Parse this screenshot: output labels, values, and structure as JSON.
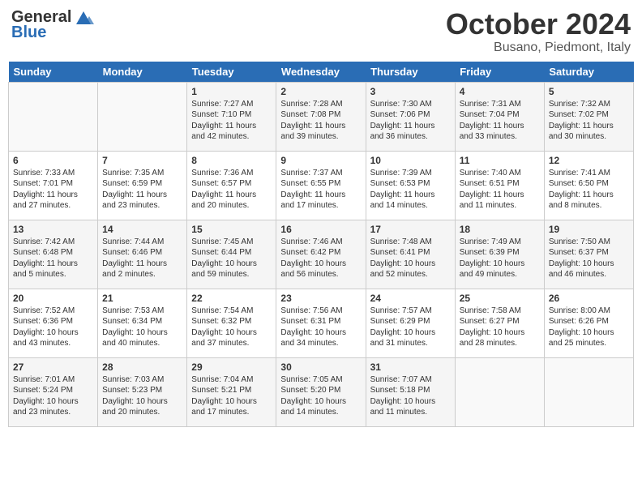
{
  "header": {
    "logo_general": "General",
    "logo_blue": "Blue",
    "month": "October 2024",
    "location": "Busano, Piedmont, Italy"
  },
  "days_of_week": [
    "Sunday",
    "Monday",
    "Tuesday",
    "Wednesday",
    "Thursday",
    "Friday",
    "Saturday"
  ],
  "weeks": [
    [
      {
        "day": "",
        "sunrise": "",
        "sunset": "",
        "daylight": ""
      },
      {
        "day": "",
        "sunrise": "",
        "sunset": "",
        "daylight": ""
      },
      {
        "day": "1",
        "sunrise": "Sunrise: 7:27 AM",
        "sunset": "Sunset: 7:10 PM",
        "daylight": "Daylight: 11 hours and 42 minutes."
      },
      {
        "day": "2",
        "sunrise": "Sunrise: 7:28 AM",
        "sunset": "Sunset: 7:08 PM",
        "daylight": "Daylight: 11 hours and 39 minutes."
      },
      {
        "day": "3",
        "sunrise": "Sunrise: 7:30 AM",
        "sunset": "Sunset: 7:06 PM",
        "daylight": "Daylight: 11 hours and 36 minutes."
      },
      {
        "day": "4",
        "sunrise": "Sunrise: 7:31 AM",
        "sunset": "Sunset: 7:04 PM",
        "daylight": "Daylight: 11 hours and 33 minutes."
      },
      {
        "day": "5",
        "sunrise": "Sunrise: 7:32 AM",
        "sunset": "Sunset: 7:02 PM",
        "daylight": "Daylight: 11 hours and 30 minutes."
      }
    ],
    [
      {
        "day": "6",
        "sunrise": "Sunrise: 7:33 AM",
        "sunset": "Sunset: 7:01 PM",
        "daylight": "Daylight: 11 hours and 27 minutes."
      },
      {
        "day": "7",
        "sunrise": "Sunrise: 7:35 AM",
        "sunset": "Sunset: 6:59 PM",
        "daylight": "Daylight: 11 hours and 23 minutes."
      },
      {
        "day": "8",
        "sunrise": "Sunrise: 7:36 AM",
        "sunset": "Sunset: 6:57 PM",
        "daylight": "Daylight: 11 hours and 20 minutes."
      },
      {
        "day": "9",
        "sunrise": "Sunrise: 7:37 AM",
        "sunset": "Sunset: 6:55 PM",
        "daylight": "Daylight: 11 hours and 17 minutes."
      },
      {
        "day": "10",
        "sunrise": "Sunrise: 7:39 AM",
        "sunset": "Sunset: 6:53 PM",
        "daylight": "Daylight: 11 hours and 14 minutes."
      },
      {
        "day": "11",
        "sunrise": "Sunrise: 7:40 AM",
        "sunset": "Sunset: 6:51 PM",
        "daylight": "Daylight: 11 hours and 11 minutes."
      },
      {
        "day": "12",
        "sunrise": "Sunrise: 7:41 AM",
        "sunset": "Sunset: 6:50 PM",
        "daylight": "Daylight: 11 hours and 8 minutes."
      }
    ],
    [
      {
        "day": "13",
        "sunrise": "Sunrise: 7:42 AM",
        "sunset": "Sunset: 6:48 PM",
        "daylight": "Daylight: 11 hours and 5 minutes."
      },
      {
        "day": "14",
        "sunrise": "Sunrise: 7:44 AM",
        "sunset": "Sunset: 6:46 PM",
        "daylight": "Daylight: 11 hours and 2 minutes."
      },
      {
        "day": "15",
        "sunrise": "Sunrise: 7:45 AM",
        "sunset": "Sunset: 6:44 PM",
        "daylight": "Daylight: 10 hours and 59 minutes."
      },
      {
        "day": "16",
        "sunrise": "Sunrise: 7:46 AM",
        "sunset": "Sunset: 6:42 PM",
        "daylight": "Daylight: 10 hours and 56 minutes."
      },
      {
        "day": "17",
        "sunrise": "Sunrise: 7:48 AM",
        "sunset": "Sunset: 6:41 PM",
        "daylight": "Daylight: 10 hours and 52 minutes."
      },
      {
        "day": "18",
        "sunrise": "Sunrise: 7:49 AM",
        "sunset": "Sunset: 6:39 PM",
        "daylight": "Daylight: 10 hours and 49 minutes."
      },
      {
        "day": "19",
        "sunrise": "Sunrise: 7:50 AM",
        "sunset": "Sunset: 6:37 PM",
        "daylight": "Daylight: 10 hours and 46 minutes."
      }
    ],
    [
      {
        "day": "20",
        "sunrise": "Sunrise: 7:52 AM",
        "sunset": "Sunset: 6:36 PM",
        "daylight": "Daylight: 10 hours and 43 minutes."
      },
      {
        "day": "21",
        "sunrise": "Sunrise: 7:53 AM",
        "sunset": "Sunset: 6:34 PM",
        "daylight": "Daylight: 10 hours and 40 minutes."
      },
      {
        "day": "22",
        "sunrise": "Sunrise: 7:54 AM",
        "sunset": "Sunset: 6:32 PM",
        "daylight": "Daylight: 10 hours and 37 minutes."
      },
      {
        "day": "23",
        "sunrise": "Sunrise: 7:56 AM",
        "sunset": "Sunset: 6:31 PM",
        "daylight": "Daylight: 10 hours and 34 minutes."
      },
      {
        "day": "24",
        "sunrise": "Sunrise: 7:57 AM",
        "sunset": "Sunset: 6:29 PM",
        "daylight": "Daylight: 10 hours and 31 minutes."
      },
      {
        "day": "25",
        "sunrise": "Sunrise: 7:58 AM",
        "sunset": "Sunset: 6:27 PM",
        "daylight": "Daylight: 10 hours and 28 minutes."
      },
      {
        "day": "26",
        "sunrise": "Sunrise: 8:00 AM",
        "sunset": "Sunset: 6:26 PM",
        "daylight": "Daylight: 10 hours and 25 minutes."
      }
    ],
    [
      {
        "day": "27",
        "sunrise": "Sunrise: 7:01 AM",
        "sunset": "Sunset: 5:24 PM",
        "daylight": "Daylight: 10 hours and 23 minutes."
      },
      {
        "day": "28",
        "sunrise": "Sunrise: 7:03 AM",
        "sunset": "Sunset: 5:23 PM",
        "daylight": "Daylight: 10 hours and 20 minutes."
      },
      {
        "day": "29",
        "sunrise": "Sunrise: 7:04 AM",
        "sunset": "Sunset: 5:21 PM",
        "daylight": "Daylight: 10 hours and 17 minutes."
      },
      {
        "day": "30",
        "sunrise": "Sunrise: 7:05 AM",
        "sunset": "Sunset: 5:20 PM",
        "daylight": "Daylight: 10 hours and 14 minutes."
      },
      {
        "day": "31",
        "sunrise": "Sunrise: 7:07 AM",
        "sunset": "Sunset: 5:18 PM",
        "daylight": "Daylight: 10 hours and 11 minutes."
      },
      {
        "day": "",
        "sunrise": "",
        "sunset": "",
        "daylight": ""
      },
      {
        "day": "",
        "sunrise": "",
        "sunset": "",
        "daylight": ""
      }
    ]
  ]
}
